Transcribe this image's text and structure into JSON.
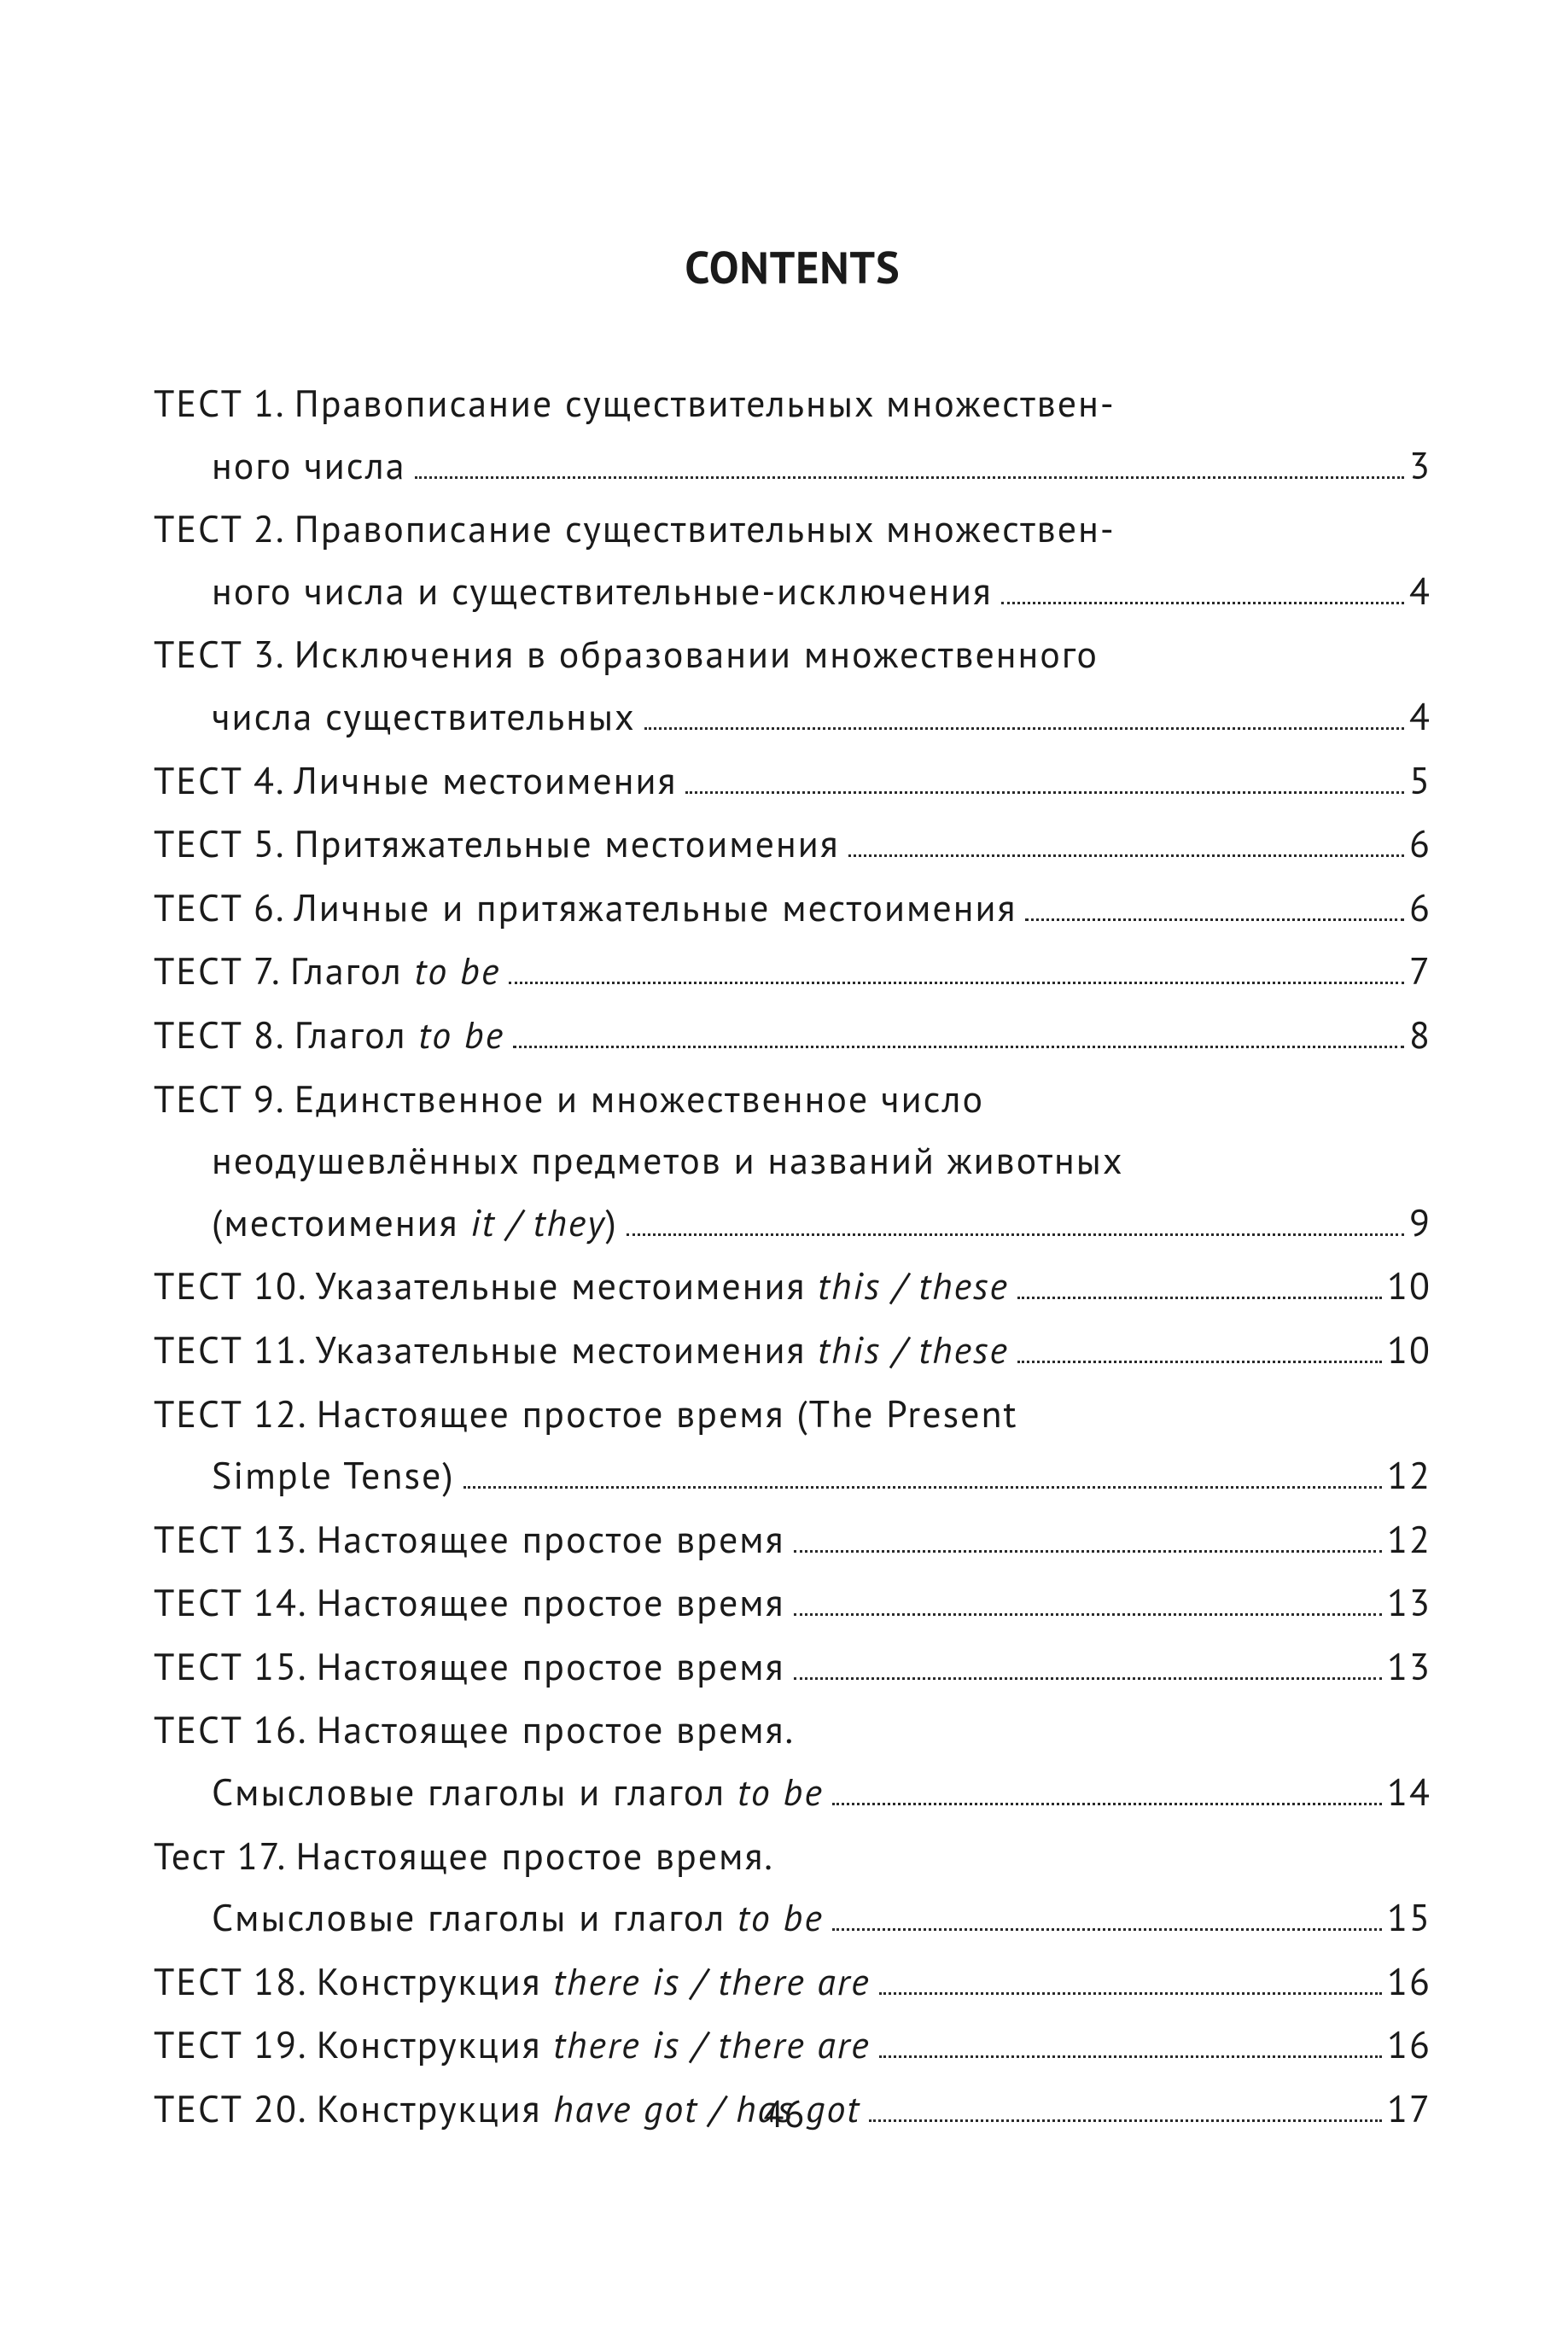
{
  "title": "CONTENTS",
  "page_number": "46",
  "entries": [
    {
      "lines": [
        {
          "segments": [
            {
              "t": "ТЕСТ 1. Правописание существительных множествен-"
            }
          ],
          "leader": false,
          "page": null
        },
        {
          "segments": [
            {
              "t": "ного числа"
            }
          ],
          "leader": true,
          "page": "3",
          "indent": true
        }
      ]
    },
    {
      "lines": [
        {
          "segments": [
            {
              "t": "ТЕСТ 2. Правописание существительных множествен-"
            }
          ],
          "leader": false,
          "page": null
        },
        {
          "segments": [
            {
              "t": "ного числа и существительные-исключения"
            }
          ],
          "leader": true,
          "page": "4",
          "indent": true
        }
      ]
    },
    {
      "lines": [
        {
          "segments": [
            {
              "t": "ТЕСТ 3. Исключения в образовании множественного"
            }
          ],
          "leader": false,
          "page": null
        },
        {
          "segments": [
            {
              "t": "числа существительных"
            }
          ],
          "leader": true,
          "page": "4",
          "indent": true
        }
      ]
    },
    {
      "lines": [
        {
          "segments": [
            {
              "t": "ТЕСТ 4. Личные местоимения"
            }
          ],
          "leader": true,
          "page": "5"
        }
      ]
    },
    {
      "lines": [
        {
          "segments": [
            {
              "t": "ТЕСТ 5. Притяжательные местоимения"
            }
          ],
          "leader": true,
          "page": "6"
        }
      ]
    },
    {
      "lines": [
        {
          "segments": [
            {
              "t": "ТЕСТ 6. Личные и притяжательные местоимения"
            }
          ],
          "leader": true,
          "page": "6"
        }
      ]
    },
    {
      "lines": [
        {
          "segments": [
            {
              "t": "ТЕСТ 7. Глагол "
            },
            {
              "t": "to be",
              "it": true
            }
          ],
          "leader": true,
          "page": "7"
        }
      ]
    },
    {
      "lines": [
        {
          "segments": [
            {
              "t": "ТЕСТ 8. Глагол "
            },
            {
              "t": "to be",
              "it": true
            }
          ],
          "leader": true,
          "page": "8"
        }
      ]
    },
    {
      "lines": [
        {
          "segments": [
            {
              "t": "ТЕСТ 9. Единственное и множественное число"
            }
          ],
          "leader": false,
          "page": null
        },
        {
          "segments": [
            {
              "t": "неодушевлённых предметов и названий животных"
            }
          ],
          "leader": false,
          "page": null,
          "indent": true
        },
        {
          "segments": [
            {
              "t": "(местоимения "
            },
            {
              "t": "it / they",
              "it": true
            },
            {
              "t": ")"
            }
          ],
          "leader": true,
          "page": "9",
          "indent": true
        }
      ]
    },
    {
      "lines": [
        {
          "segments": [
            {
              "t": "ТЕСТ 10. Указательные местоимения "
            },
            {
              "t": "this / these",
              "it": true
            }
          ],
          "leader": true,
          "page": "10"
        }
      ]
    },
    {
      "lines": [
        {
          "segments": [
            {
              "t": "ТЕСТ 11. Указательные местоимения "
            },
            {
              "t": "this / these",
              "it": true
            }
          ],
          "leader": true,
          "page": "10"
        }
      ]
    },
    {
      "lines": [
        {
          "segments": [
            {
              "t": "ТЕСТ 12. Настоящее простое время (The Present"
            }
          ],
          "leader": false,
          "page": null
        },
        {
          "segments": [
            {
              "t": "Simple Tense)"
            }
          ],
          "leader": true,
          "page": "12",
          "indent": true
        }
      ]
    },
    {
      "lines": [
        {
          "segments": [
            {
              "t": "ТЕСТ 13. Настоящее простое время"
            }
          ],
          "leader": true,
          "page": "12"
        }
      ]
    },
    {
      "lines": [
        {
          "segments": [
            {
              "t": "ТЕСТ 14. Настоящее простое время"
            }
          ],
          "leader": true,
          "page": "13"
        }
      ]
    },
    {
      "lines": [
        {
          "segments": [
            {
              "t": "ТЕСТ 15. Настоящее простое время"
            }
          ],
          "leader": true,
          "page": "13"
        }
      ]
    },
    {
      "lines": [
        {
          "segments": [
            {
              "t": "ТЕСТ 16. Настоящее простое время."
            }
          ],
          "leader": false,
          "page": null
        },
        {
          "segments": [
            {
              "t": "Смысловые глаголы и глагол "
            },
            {
              "t": "to be",
              "it": true
            }
          ],
          "leader": true,
          "page": "14",
          "indent": true
        }
      ]
    },
    {
      "lines": [
        {
          "segments": [
            {
              "t": "Тест 17. Настоящее простое время."
            }
          ],
          "leader": false,
          "page": null
        },
        {
          "segments": [
            {
              "t": "Смысловые глаголы и глагол "
            },
            {
              "t": "to be",
              "it": true
            }
          ],
          "leader": true,
          "page": "15",
          "indent": true
        }
      ]
    },
    {
      "lines": [
        {
          "segments": [
            {
              "t": "ТЕСТ 18. Конструкция "
            },
            {
              "t": "there is / there are",
              "it": true
            }
          ],
          "leader": true,
          "page": "16"
        }
      ]
    },
    {
      "lines": [
        {
          "segments": [
            {
              "t": "ТЕСТ 19. Конструкция "
            },
            {
              "t": "there is / there are",
              "it": true
            }
          ],
          "leader": true,
          "page": "16"
        }
      ]
    },
    {
      "lines": [
        {
          "segments": [
            {
              "t": "ТЕСТ 20. Конструкция "
            },
            {
              "t": "have got / has got",
              "it": true
            }
          ],
          "leader": true,
          "page": "17"
        }
      ]
    }
  ]
}
